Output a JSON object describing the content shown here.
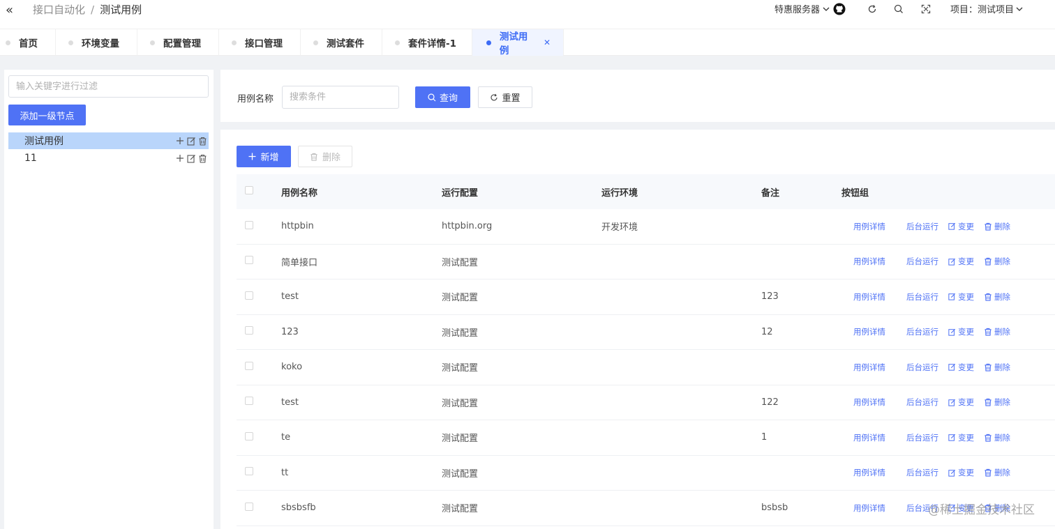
{
  "header": {
    "collapse_icon": "double-chevron-left",
    "breadcrumb": [
      "接口自动化",
      "测试用例"
    ],
    "breadcrumb_sep": "/",
    "server_label": "特惠服务器",
    "project_label": "项目：测试项目"
  },
  "tabs": [
    {
      "label": "首页",
      "active": false
    },
    {
      "label": "环境变量",
      "active": false
    },
    {
      "label": "配置管理",
      "active": false
    },
    {
      "label": "接口管理",
      "active": false
    },
    {
      "label": "测试套件",
      "active": false
    },
    {
      "label": "套件详情-1",
      "active": false
    },
    {
      "label": "测试用例",
      "active": true
    }
  ],
  "sidebar": {
    "filter_placeholder": "输入关键字进行过滤",
    "add_root_label": "添加一级节点",
    "tree": [
      {
        "label": "测试用例",
        "selected": true
      },
      {
        "label": "11",
        "selected": false
      }
    ]
  },
  "search": {
    "label": "用例名称",
    "placeholder": "搜索条件",
    "value": "",
    "query_label": "查询",
    "reset_label": "重置"
  },
  "toolbar": {
    "add_label": "新增",
    "delete_label": "删除"
  },
  "table": {
    "columns": [
      "用例名称",
      "运行配置",
      "运行环境",
      "备注",
      "按钮组"
    ],
    "action_labels": {
      "detail": "用例详情",
      "run": "后台运行",
      "edit": "变更",
      "delete": "删除"
    },
    "rows": [
      {
        "name": "httpbin",
        "config": "httpbin.org",
        "env": "开发环境",
        "note": ""
      },
      {
        "name": "简单接口",
        "config": "测试配置",
        "env": "",
        "note": ""
      },
      {
        "name": "test",
        "config": "测试配置",
        "env": "",
        "note": "123"
      },
      {
        "name": "123",
        "config": "测试配置",
        "env": "",
        "note": "12"
      },
      {
        "name": "koko",
        "config": "测试配置",
        "env": "",
        "note": ""
      },
      {
        "name": "test",
        "config": "测试配置",
        "env": "",
        "note": "122"
      },
      {
        "name": "te",
        "config": "测试配置",
        "env": "",
        "note": "1"
      },
      {
        "name": "tt",
        "config": "测试配置",
        "env": "",
        "note": ""
      },
      {
        "name": "sbsbsfb",
        "config": "测试配置",
        "env": "",
        "note": "bsbsb"
      }
    ]
  },
  "watermark": "@稀土掘金技术社区",
  "colors": {
    "primary": "#4f72f5",
    "selected_node": "#b9d5fb",
    "active_tab_bg": "#f0f4ff"
  }
}
